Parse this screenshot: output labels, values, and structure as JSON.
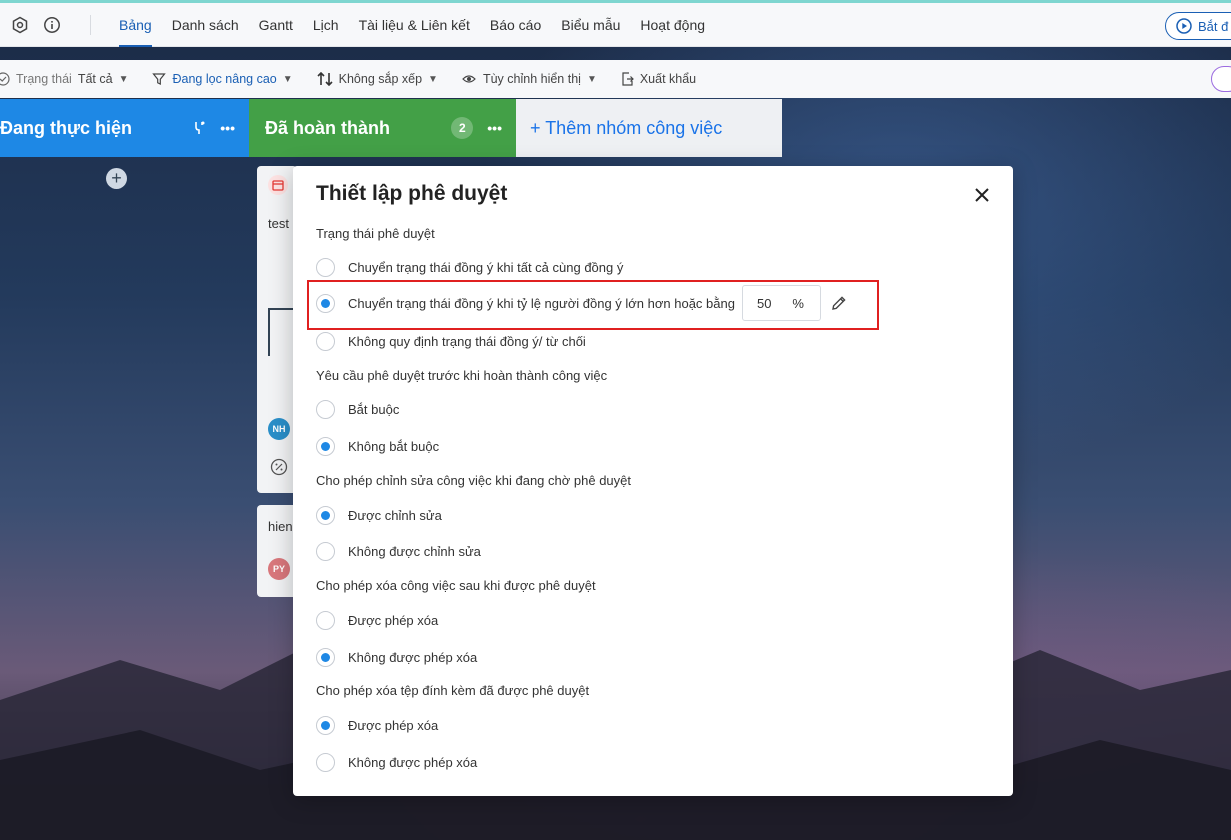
{
  "topbar": {
    "tabs": [
      {
        "label": "Bảng",
        "active": true
      },
      {
        "label": "Danh sách"
      },
      {
        "label": "Gantt"
      },
      {
        "label": "Lịch"
      },
      {
        "label": "Tài liệu & Liên kết"
      },
      {
        "label": "Báo cáo"
      },
      {
        "label": "Biểu mẫu"
      },
      {
        "label": "Hoạt động"
      }
    ],
    "start_label": "Bắt đ"
  },
  "filters": {
    "status_label": "Trạng thái",
    "status_value": "Tất cả",
    "advanced_filter": "Đang lọc nâng cao",
    "sort": "Không sắp xếp",
    "display": "Tùy chỉnh hiển thị",
    "export": "Xuất khẩu"
  },
  "columns": {
    "in_progress": "Đang thực hiện",
    "done": "Đã hoàn thành",
    "done_count": "2",
    "add_group": "+ Thêm nhóm công việc"
  },
  "cards": {
    "card1_title": "test",
    "card1_avatar": "NH",
    "card2_title": "hien",
    "card2_avatar": "PY"
  },
  "modal": {
    "title": "Thiết lập phê duyệt",
    "sections": {
      "status": "Trạng thái phê duyệt",
      "require": "Yêu cầu phê duyệt trước khi hoàn thành công việc",
      "edit": "Cho phép chỉnh sửa công việc khi đang chờ phê duyệt",
      "delete_task": "Cho phép xóa công việc sau khi được phê duyệt",
      "delete_attach": "Cho phép xóa tệp đính kèm đã được phê duyệt"
    },
    "options": {
      "status_all": "Chuyển trạng thái đồng ý khi tất cả cùng đồng ý",
      "status_ratio": "Chuyển trạng thái đồng ý khi tỷ lệ người đồng ý lớn hơn hoặc bằng",
      "status_none": "Không quy định trạng thái đồng ý/ từ chối",
      "require_yes": "Bắt buộc",
      "require_no": "Không bắt buộc",
      "edit_yes": "Được chỉnh sửa",
      "edit_no": "Không được chỉnh sửa",
      "delete_task_yes": "Được phép xóa",
      "delete_task_no": "Không được phép xóa",
      "delete_attach_yes": "Được phép xóa",
      "delete_attach_no": "Không được phép xóa"
    },
    "ratio_value": "50",
    "ratio_unit": "%"
  },
  "colors": {
    "accent": "#1e88e5",
    "highlight": "#e02020",
    "column_blue": "#1e88e5",
    "column_green": "#43a047"
  }
}
